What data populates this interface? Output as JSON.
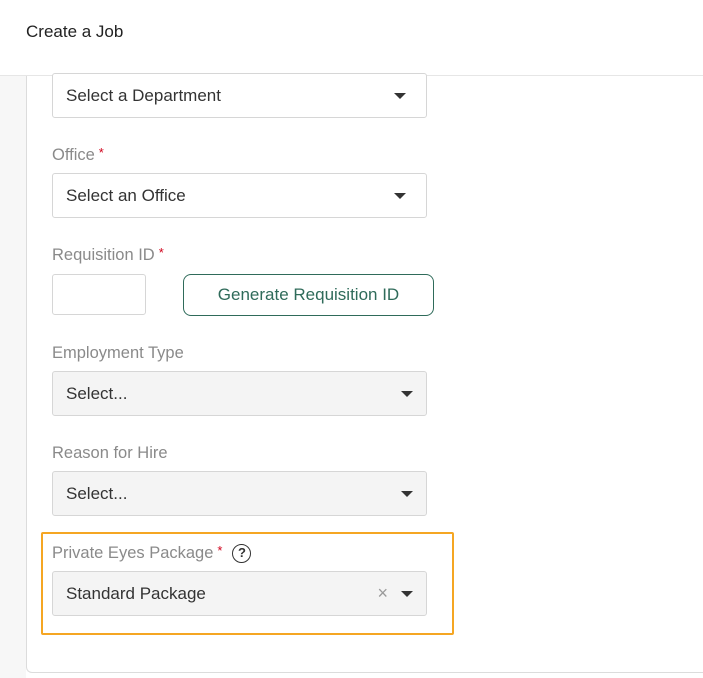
{
  "header": {
    "title": "Create a Job"
  },
  "form": {
    "department": {
      "value": "Select a Department"
    },
    "office": {
      "label": "Office",
      "value": "Select an Office"
    },
    "requisition": {
      "label": "Requisition ID",
      "value": "",
      "generate_label": "Generate Requisition ID"
    },
    "employment_type": {
      "label": "Employment Type",
      "value": "Select..."
    },
    "reason_for_hire": {
      "label": "Reason for Hire",
      "value": "Select..."
    },
    "private_eyes": {
      "label": "Private Eyes Package",
      "help_glyph": "?",
      "value": "Standard Package",
      "clear_glyph": "×"
    },
    "required_marker": "*"
  },
  "colors": {
    "accent_green": "#2f6b5a",
    "highlight_orange": "#f5a623",
    "required_red": "#d0021b"
  },
  "icons": {
    "dropdown": "caret-down-icon",
    "clear": "close-icon",
    "help": "question-circle-icon"
  }
}
